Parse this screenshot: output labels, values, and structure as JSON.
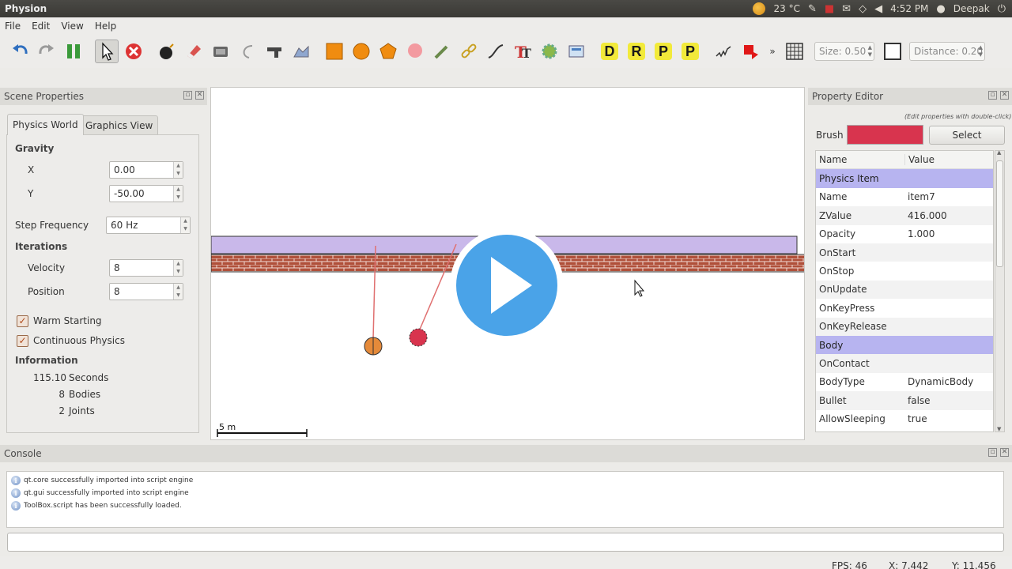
{
  "app_title": "Physion",
  "tray": {
    "temperature": "23 °C",
    "time": "4:52 PM",
    "user": "Deepak"
  },
  "menu": [
    "File",
    "Edit",
    "View",
    "Help"
  ],
  "toolbar": {
    "size_value": "Size: 0.50",
    "distance_value": "Distance: 0.20",
    "letters": [
      "D",
      "R",
      "P",
      "P"
    ]
  },
  "scene_properties": {
    "title": "Scene Properties",
    "tab_physics": "Physics World",
    "tab_graphics": "Graphics View",
    "gravity_label": "Gravity",
    "x_label": "X",
    "x_value": "0.00",
    "y_label": "Y",
    "y_value": "-50.00",
    "step_label": "Step Frequency",
    "step_value": "60 Hz",
    "iterations_label": "Iterations",
    "velocity_label": "Velocity",
    "velocity_value": "8",
    "position_label": "Position",
    "position_value": "8",
    "warm_label": "Warm Starting",
    "continuous_label": "Continuous Physics",
    "info_label": "Information",
    "seconds_num": "115.10",
    "seconds_label": "Seconds",
    "bodies_num": "8",
    "bodies_label": "Bodies",
    "joints_num": "2",
    "joints_label": "Joints"
  },
  "canvas": {
    "scale_label": "5 m"
  },
  "property_editor": {
    "title": "Property Editor",
    "hint": "(Edit properties with double-click)",
    "brush_label": "Brush",
    "brush_color": "#d8344e",
    "select_label": "Select",
    "col_name": "Name",
    "col_value": "Value",
    "rows": [
      {
        "k": "Physics Item",
        "v": ""
      },
      {
        "k": "Name",
        "v": "item7"
      },
      {
        "k": "ZValue",
        "v": "416.000"
      },
      {
        "k": "Opacity",
        "v": "1.000"
      },
      {
        "k": "OnStart",
        "v": ""
      },
      {
        "k": "OnStop",
        "v": ""
      },
      {
        "k": "OnUpdate",
        "v": ""
      },
      {
        "k": "OnKeyPress",
        "v": ""
      },
      {
        "k": "OnKeyRelease",
        "v": ""
      },
      {
        "k": "Body",
        "v": ""
      },
      {
        "k": "OnContact",
        "v": ""
      },
      {
        "k": "BodyType",
        "v": "DynamicBody"
      },
      {
        "k": "Bullet",
        "v": "false"
      },
      {
        "k": "AllowSleeping",
        "v": "true"
      }
    ]
  },
  "console": {
    "title": "Console",
    "lines": [
      "qt.core successfully imported into script engine",
      "qt.gui successfully imported into script engine",
      "ToolBox.script has been successfully loaded."
    ]
  },
  "status": {
    "fps": "FPS: 46",
    "x": "X: 7.442",
    "y": "Y: 11.456"
  }
}
